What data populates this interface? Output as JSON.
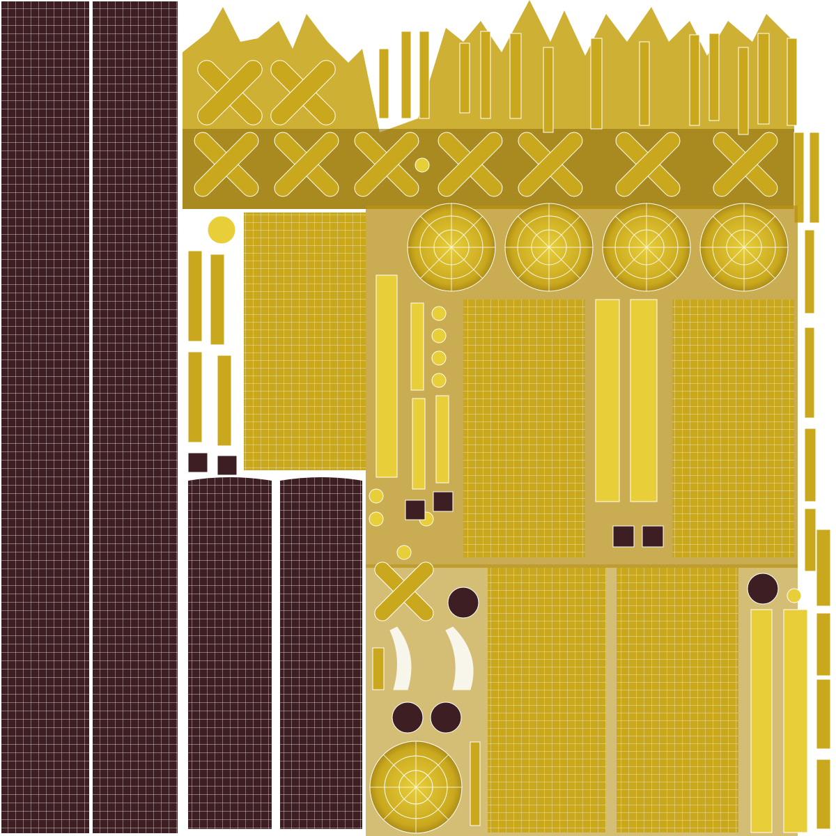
{
  "texture": {
    "background": "#ffffff",
    "wood_dark": "#3d1e22",
    "wood_mid": "#4a2a2c",
    "gold": "#c9a81e",
    "gold_light": "#e8cf3a",
    "gold_dark": "#8a6a10",
    "rust": "#6b2c12",
    "wire": "#ffffff"
  }
}
